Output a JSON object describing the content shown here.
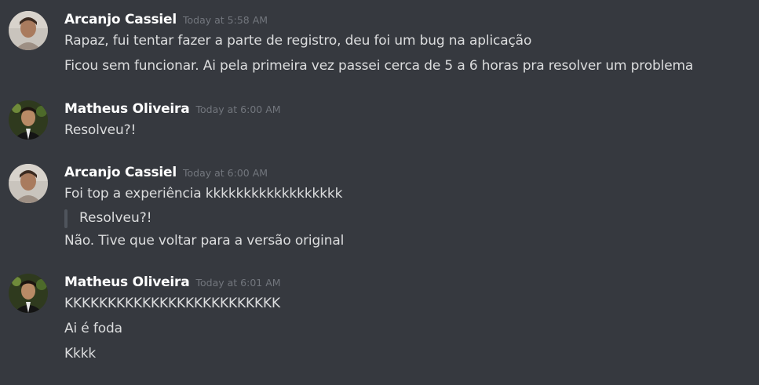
{
  "messages": [
    {
      "author": "Arcanjo Cassiel",
      "timestamp": "Today at 5:58 AM",
      "avatar": "avatar-arcanjo",
      "lines": [
        "Rapaz, fui tentar fazer  a parte de registro, deu foi um bug na aplicação",
        "Ficou sem funcionar. Ai pela primeira vez passei cerca de 5 a 6 horas pra resolver um problema"
      ]
    },
    {
      "author": "Matheus Oliveira",
      "timestamp": "Today at 6:00 AM",
      "avatar": "avatar-matheus",
      "lines": [
        "Resolveu?!"
      ]
    },
    {
      "author": "Arcanjo Cassiel",
      "timestamp": "Today at 6:00 AM",
      "avatar": "avatar-arcanjo",
      "lines": [
        "Foi top a experiência kkkkkkkkkkkkkkkkkk"
      ],
      "quote": "Resolveu?!",
      "after_quote": [
        "Não. Tive que voltar para a versão original"
      ]
    },
    {
      "author": "Matheus Oliveira",
      "timestamp": "Today at 6:01 AM",
      "avatar": "avatar-matheus",
      "lines": [
        "KKKKKKKKKKKKKKKKKKKKKKKKK",
        "Ai é foda",
        "Kkkk"
      ]
    }
  ],
  "colors": {
    "background": "#36393f",
    "username": "#ffffff",
    "timestamp": "#72767d",
    "message_text": "#dcddde",
    "quote_bar": "#4f545c"
  }
}
